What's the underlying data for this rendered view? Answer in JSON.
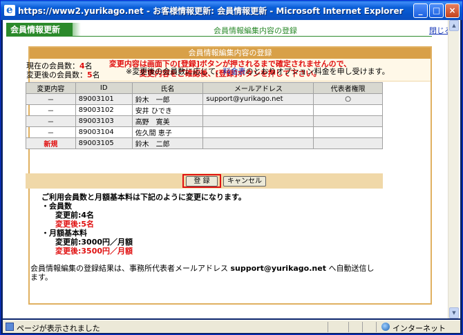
{
  "window": {
    "title": "https://www2.yurikago.net - お客様情報更新: 会員情報更新 - Microsoft Internet Explorer",
    "min": "_",
    "max": "□",
    "close": "×"
  },
  "header": {
    "tag": "会員情報更新",
    "subtitle": "会員情報編集内容の登録",
    "close_link": "閉じる"
  },
  "box": {
    "title": "会員情報編集内容の登録",
    "warning_line1": "変更内容は画面下の[登録]ボタンが押されるまで確定されませんので、",
    "warning_line2": "変更内容をご確認後、[登録]ボタンを押して下さい。"
  },
  "counts": {
    "current_label": "現在の会員数",
    "current_sep": "：",
    "current_value": "4",
    "current_unit": "名",
    "after_label": "変更後の会員数",
    "after_sep": "：",
    "after_value": "5",
    "after_unit": "名"
  },
  "note": {
    "prefix": "※変更後の会員数に応じて、",
    "link": "料金表",
    "suffix": "のとおりオプション料金を申し受けます。"
  },
  "table": {
    "headers": [
      "変更内容",
      "ID",
      "氏名",
      "メールアドレス",
      "代表者権限"
    ],
    "rows": [
      {
        "change": "－",
        "id": "89003101",
        "name": "鈴木　一郎",
        "email": "support@yurikago.net",
        "rep": "○"
      },
      {
        "change": "－",
        "id": "89003102",
        "name": "安井 ひでき",
        "email": "",
        "rep": ""
      },
      {
        "change": "－",
        "id": "89003103",
        "name": "高野　寛美",
        "email": "",
        "rep": ""
      },
      {
        "change": "－",
        "id": "89003104",
        "name": "佐久間 恵子",
        "email": "",
        "rep": ""
      },
      {
        "change": "新規",
        "id": "89003105",
        "name": "鈴木　二郎",
        "email": "",
        "rep": ""
      }
    ]
  },
  "buttons": {
    "register": "登 録",
    "cancel": "キャンセル"
  },
  "summary": {
    "intro": "ご利用会員数と月額基本料は下記のように変更になります。",
    "members_heading": "・会員数",
    "members_before": "変更前:4名",
    "members_after": "変更後:5名",
    "fee_heading": "・月額基本料",
    "fee_before": "変更前:3000円／月額",
    "fee_after": "変更後:3500円／月額"
  },
  "footer": {
    "prefix": "会員情報編集の登録結果は、事務所代表者メールアドレス ",
    "email": "support@yurikago.net",
    "suffix": " へ自動送信します。"
  },
  "statusbar": {
    "text": "ページが表示されました",
    "zone": "インターネット"
  }
}
